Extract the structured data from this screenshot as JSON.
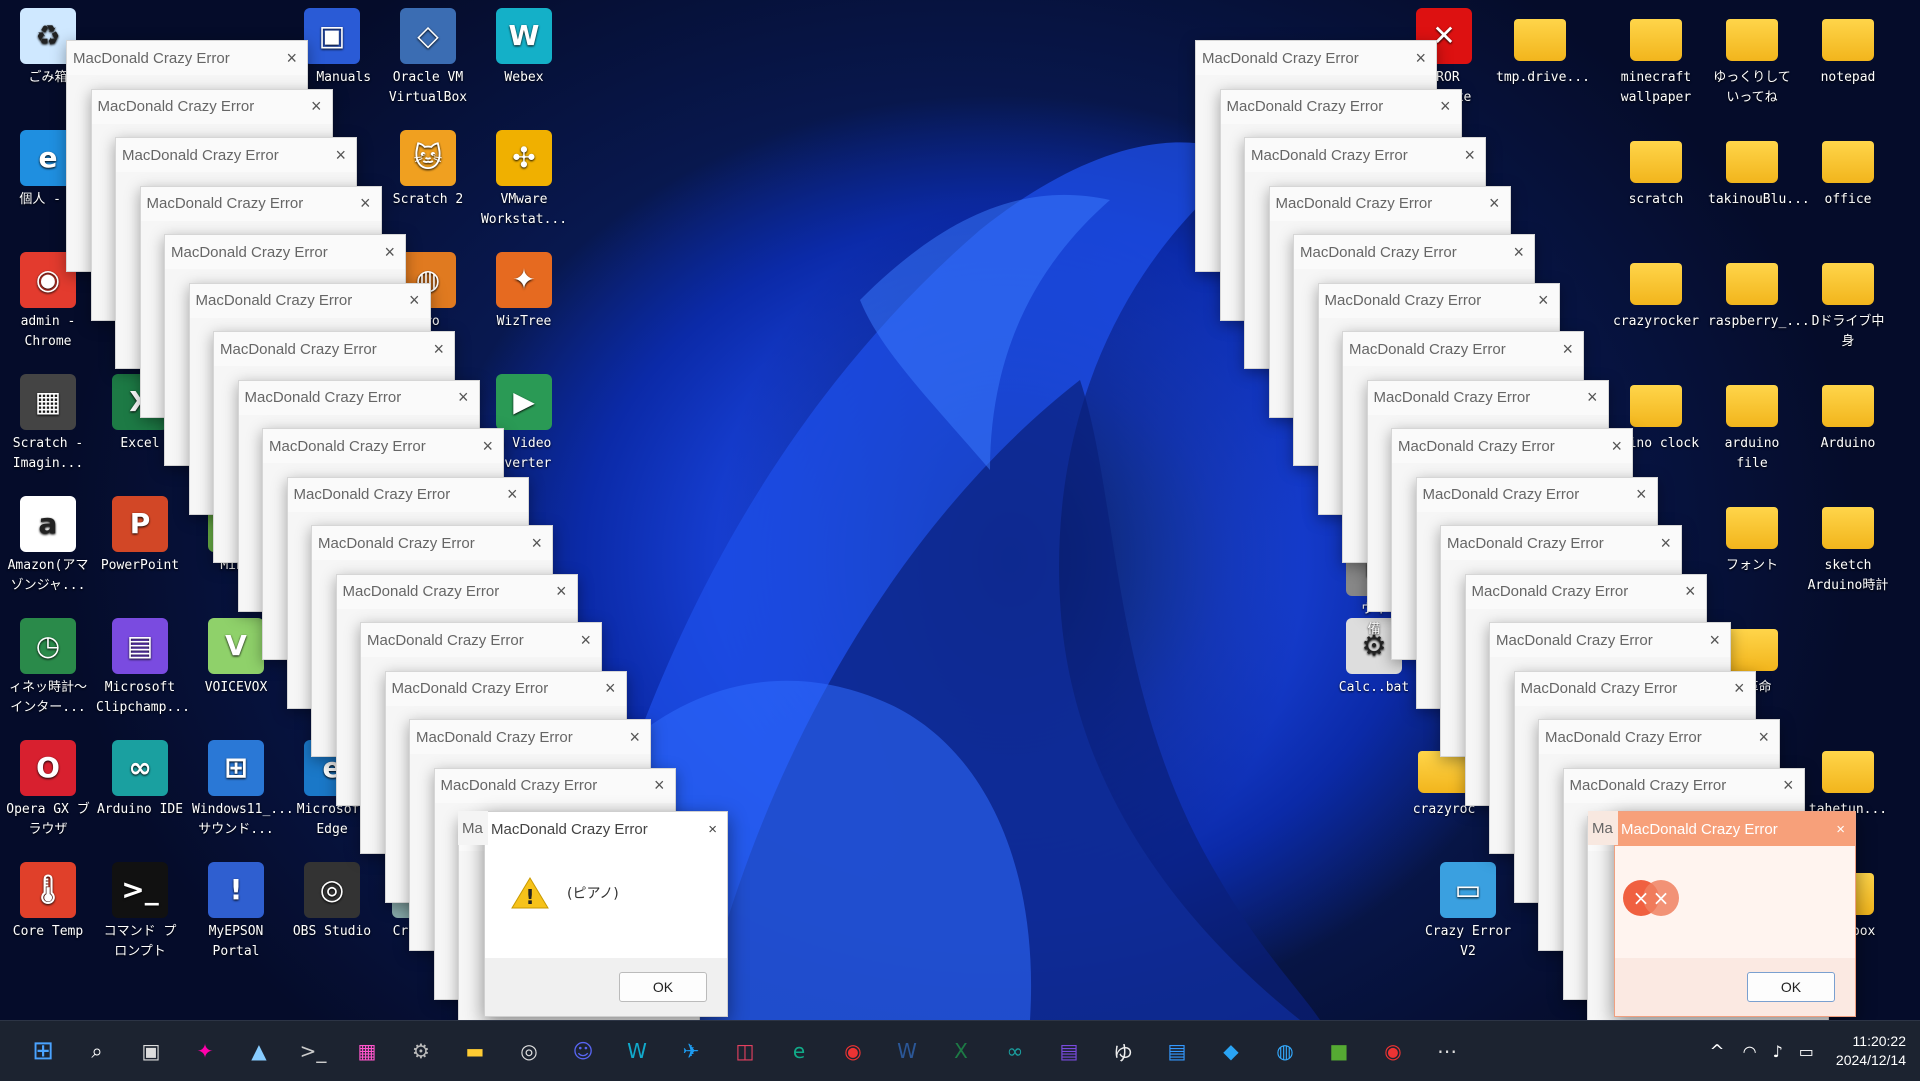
{
  "desktop_icons": [
    {
      "label": "ごみ箱",
      "icon": "recycle-bin-icon",
      "color": "#cfe8ff",
      "glyph": "♻"
    },
    {
      "label": "個人 - E",
      "icon": "edge-icon",
      "color": "#1f8fe0",
      "glyph": "e"
    },
    {
      "label": "admin -\nChrome",
      "icon": "chrome-icon",
      "color": "#e33b2e",
      "glyph": "◉"
    },
    {
      "label": "Scratch -\nImagin...",
      "icon": "chip-icon",
      "color": "#444",
      "glyph": "▦"
    },
    {
      "label": "Amazon(アマ\nゾンジャ...",
      "icon": "amazon-icon",
      "color": "#ffffff",
      "glyph": "a"
    },
    {
      "label": "ィネッ時計～\nインター...",
      "icon": "clock-app-icon",
      "color": "#2a8a4a",
      "glyph": "◷"
    },
    {
      "label": "Opera GX ブ\nラウザ",
      "icon": "opera-icon",
      "color": "#d8202f",
      "glyph": "O"
    },
    {
      "label": "Core Temp",
      "icon": "thermometer-icon",
      "color": "#e0402a",
      "glyph": "🌡"
    },
    {
      "label": "Excel",
      "icon": "excel-icon",
      "color": "#1d7a45",
      "glyph": "X"
    },
    {
      "label": "PowerPoint",
      "icon": "powerpoint-icon",
      "color": "#d24726",
      "glyph": "P"
    },
    {
      "label": "Microsoft\nClipchamp...",
      "icon": "clipchamp-icon",
      "color": "#7a4be0",
      "glyph": "▤"
    },
    {
      "label": "Arduino IDE",
      "icon": "arduino-icon",
      "color": "#1aa0a0",
      "glyph": "∞"
    },
    {
      "label": "コマンド プ\nロンプト",
      "icon": "terminal-icon",
      "color": "#111",
      "glyph": ">_"
    },
    {
      "label": "VOICEVOX",
      "icon": "voicevox-icon",
      "color": "#8fd16a",
      "glyph": "V"
    },
    {
      "label": "Windows11_...\nサウンド...",
      "icon": "windows-sound-icon",
      "color": "#2a78d6",
      "glyph": "⊞"
    },
    {
      "label": "MyEPSON\nPortal",
      "icon": "epson-icon",
      "color": "#2f5fd0",
      "glyph": "!"
    },
    {
      "label": "on Manuals",
      "icon": "manuals-icon",
      "color": "#2a5bd6",
      "glyph": "▣"
    },
    {
      "label": "Oracle VM\nVirtualBox",
      "icon": "virtualbox-icon",
      "color": "#3b6db3",
      "glyph": "◇"
    },
    {
      "label": "Webex",
      "icon": "webex-icon",
      "color": "#14b0c8",
      "glyph": "W"
    },
    {
      "label": "Scratch 2",
      "icon": "scratch-cat-icon",
      "color": "#f0a020",
      "glyph": "🐱"
    },
    {
      "label": "VMware\nWorkstat...",
      "icon": "vmware-icon",
      "color": "#f0b000",
      "glyph": "✣"
    },
    {
      "label": "WizTree",
      "icon": "wiztree-icon",
      "color": "#e66a20",
      "glyph": "✦"
    },
    {
      "label": "S Video\nnverter",
      "icon": "video-converter-icon",
      "color": "#2a9a55",
      "glyph": "▶"
    },
    {
      "label": "Microsoft\nEdge",
      "icon": "edge-icon",
      "color": "#1a78c8",
      "glyph": "e"
    },
    {
      "label": "OBS Studio",
      "icon": "obs-icon",
      "color": "#333",
      "glyph": "◎"
    },
    {
      "label": "Crystal",
      "icon": "crystal-icon",
      "color": "#8aa",
      "glyph": "◈"
    },
    {
      "label": "ero",
      "icon": "firefox-icon",
      "color": "#e07a20",
      "glyph": "◍"
    },
    {
      "label": "Mine",
      "icon": "minecraft-icon",
      "color": "#6a4",
      "glyph": "■"
    },
    {
      "label": "RROR 408.exe",
      "icon": "error-x-icon",
      "color": "#d11",
      "glyph": "✕"
    },
    {
      "label": "tmp.drive...",
      "icon": "folder-icon",
      "color": "#9a8",
      "glyph": ""
    },
    {
      "label": "minecraft\nwallpaper",
      "icon": "folder-icon",
      "color": "#ffcc40",
      "glyph": ""
    },
    {
      "label": "ゆっくりして\nいってね",
      "icon": "folder-icon",
      "color": "#ffcc40",
      "glyph": ""
    },
    {
      "label": "notepad",
      "icon": "folder-icon",
      "color": "#ffcc40",
      "glyph": ""
    },
    {
      "label": "scratch",
      "icon": "folder-icon",
      "color": "#ffcc40",
      "glyph": ""
    },
    {
      "label": "takinouBlu...",
      "icon": "folder-icon",
      "color": "#ffcc40",
      "glyph": ""
    },
    {
      "label": "office",
      "icon": "folder-icon",
      "color": "#ffcc40",
      "glyph": ""
    },
    {
      "label": "crazyrocker",
      "icon": "folder-icon",
      "color": "#ffcc40",
      "glyph": ""
    },
    {
      "label": "raspberry_...",
      "icon": "folder-icon",
      "color": "#ffcc40",
      "glyph": ""
    },
    {
      "label": "Dドライブ中\n身",
      "icon": "folder-icon",
      "color": "#ffcc40",
      "glyph": ""
    },
    {
      "label": "duino clock",
      "icon": "folder-icon",
      "color": "#ffcc40",
      "glyph": ""
    },
    {
      "label": "arduino file",
      "icon": "folder-icon",
      "color": "#ffcc40",
      "glyph": ""
    },
    {
      "label": "Arduino",
      "icon": "folder-icon",
      "color": "#ffcc40",
      "glyph": ""
    },
    {
      "label": "フォント",
      "icon": "folder-icon",
      "color": "#ffcc40",
      "glyph": ""
    },
    {
      "label": "sketch\nArduino時計",
      "icon": "folder-icon",
      "color": "#ffcc40",
      "glyph": ""
    },
    {
      "label": "命革命",
      "icon": "folder-icon",
      "color": "#ffcc40",
      "glyph": ""
    },
    {
      "label": "tahetun...",
      "icon": "folder-icon",
      "color": "#ffcc40",
      "glyph": ""
    },
    {
      "label": "oicebox",
      "icon": "folder-icon",
      "color": "#ffcc40",
      "glyph": ""
    },
    {
      "label": "Calc..bat",
      "icon": "gear-file-icon",
      "color": "#ddd",
      "glyph": "⚙"
    },
    {
      "label": "crazyroc",
      "icon": "folder-icon",
      "color": "#ffcc40",
      "glyph": ""
    },
    {
      "label": "Crazy Error\nV2",
      "icon": "crazy-error-icon",
      "color": "#3aa0e0",
      "glyph": "▭"
    },
    {
      "label": "ウイ\n備",
      "icon": "app-icon",
      "color": "#888",
      "glyph": "▪"
    }
  ],
  "error_window_title": "MacDonald Crazy Error",
  "close_glyph": "×",
  "left_dialog": {
    "title": "MacDonald Crazy Error",
    "prefix": "Ma",
    "message": "(ピアノ)",
    "ok": "OK",
    "icon": "warning-icon"
  },
  "right_dialog": {
    "title": "MacDonald Crazy Error",
    "prefix": "Ma",
    "ok": "OK",
    "icon": "error-icon"
  },
  "taskbar": {
    "items": [
      "start-icon",
      "search-icon",
      "task-view-icon",
      "copilot-icon",
      "photos-icon",
      "terminal-icon",
      "store-icon",
      "settings-icon",
      "file-explorer-icon",
      "obs-icon",
      "discord-icon",
      "webex-icon",
      "twitter-icon",
      "instagram-icon",
      "edge-icon",
      "chrome-icon",
      "word-icon",
      "excel-icon",
      "arduino-icon",
      "clipchamp-icon",
      "yukkuri-icon",
      "notepad-icon",
      "vscode-icon",
      "earth-icon",
      "minecraft-icon",
      "chrome-extra-icon",
      "more-icon"
    ],
    "glyphs": [
      "⊞",
      "⌕",
      "▣",
      "✦",
      "▲",
      ">_",
      "▦",
      "⚙",
      "▬",
      "◎",
      "☺",
      "W",
      "✈",
      "◫",
      "e",
      "◉",
      "W",
      "X",
      "∞",
      "▤",
      "ゆ",
      "▤",
      "◆",
      "◍",
      "■",
      "◉",
      "⋯"
    ],
    "colors": [
      "#4aa3ff",
      "#fff",
      "#ddd",
      "#f0a",
      "#8cf",
      "#ccc",
      "#f5c",
      "#bbb",
      "#fc3",
      "#ddd",
      "#5865f2",
      "#1ac",
      "#1d9bf0",
      "#e4405f",
      "#1a8",
      "#e33",
      "#2b5797",
      "#1d7a45",
      "#1aa0a0",
      "#7a4be0",
      "#eee",
      "#39f",
      "#2aa4f4",
      "#3af",
      "#5a3",
      "#e33",
      "#ddd"
    ]
  },
  "tray": {
    "chevron": "^",
    "clock_time": "11:20:22",
    "clock_date": "2024/12/14"
  }
}
